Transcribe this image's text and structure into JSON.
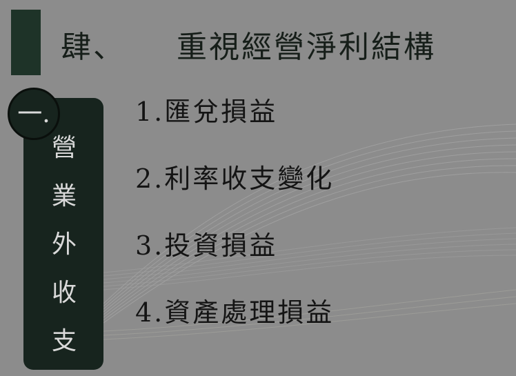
{
  "title": {
    "number": "肆、",
    "text": "重視經營淨利結構"
  },
  "side_panel": {
    "badge": "一.",
    "chars": [
      "營",
      "業",
      "外",
      "收",
      "支"
    ]
  },
  "items": [
    "1.匯兌損益",
    "2.利率收支變化",
    "3.投資損益",
    "4.資產處理損益"
  ],
  "colors": {
    "background": "#8c8c8c",
    "dark_green": "#1e3328",
    "panel": "#17241e"
  }
}
